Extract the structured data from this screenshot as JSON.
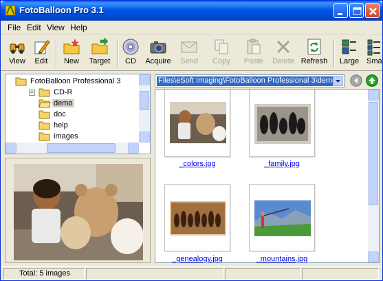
{
  "window": {
    "title": "FotoBalloon Pro 3.1"
  },
  "menu": {
    "items": [
      "File",
      "Edit",
      "View",
      "Help"
    ]
  },
  "toolbar": {
    "buttons": [
      {
        "label": "View",
        "icon": "binoculars-icon",
        "enabled": true
      },
      {
        "label": "Edit",
        "icon": "pencil-icon",
        "enabled": true
      },
      {
        "label": "New",
        "icon": "new-folder-icon",
        "enabled": true
      },
      {
        "label": "Target",
        "icon": "target-folder-icon",
        "enabled": true
      },
      {
        "label": "CD",
        "icon": "cd-icon",
        "enabled": true
      },
      {
        "label": "Acquire",
        "icon": "camera-icon",
        "enabled": true
      },
      {
        "label": "Send",
        "icon": "envelope-icon",
        "enabled": false
      },
      {
        "label": "Copy",
        "icon": "copy-icon",
        "enabled": false
      },
      {
        "label": "Paste",
        "icon": "paste-icon",
        "enabled": false
      },
      {
        "label": "Delete",
        "icon": "delete-icon",
        "enabled": false
      },
      {
        "label": "Refresh",
        "icon": "refresh-icon",
        "enabled": true
      },
      {
        "label": "Large",
        "icon": "large-icons-icon",
        "enabled": true
      },
      {
        "label": "Sma",
        "icon": "small-icons-icon",
        "enabled": true
      }
    ]
  },
  "tree": {
    "root": "FotoBalloon Professional 3",
    "children": [
      "CD-R",
      "demo",
      "doc",
      "help",
      "images"
    ],
    "selected": "demo"
  },
  "address": {
    "path": "Files\\eSoft Imaging\\FotoBalloon Professional 3\\demo\\"
  },
  "thumbnails": [
    {
      "filename": "_colors.jpg"
    },
    {
      "filename": "_family.jpg"
    },
    {
      "filename": "_genealogy.jpg"
    },
    {
      "filename": "_mountains.jpg"
    }
  ],
  "status": {
    "text": "Total: 5 images"
  },
  "colors": {
    "title_bar": "#0058e6",
    "selection": "#316ac5",
    "link": "#0000ee"
  }
}
